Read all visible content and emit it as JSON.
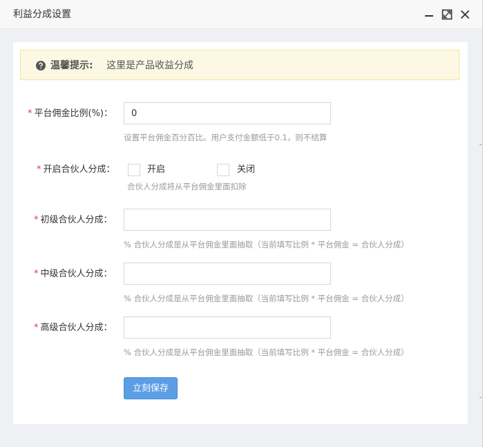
{
  "window": {
    "title": "利益分成设置",
    "controls": [
      "minimize-icon",
      "maximize-icon",
      "close-icon"
    ]
  },
  "notice": {
    "icon": "question-circle-icon",
    "strong": "温馨提示:",
    "text": "这里是产品收益分成"
  },
  "form": {
    "platform_rate": {
      "required_mark": "*",
      "label": "平台佣金比例(%)：",
      "value": "0",
      "help": "设置平台佣金百分百比。用户支付金额低于0.1，则不结算"
    },
    "partner_enable": {
      "required_mark": "*",
      "label": "开启合伙人分成：",
      "option_on": "开启",
      "option_off": "关闭",
      "help": "合伙人分成将从平台佣金里面扣除"
    },
    "level1": {
      "required_mark": "*",
      "label": "初级合伙人分成：",
      "value": "",
      "help": "% 合伙人分成是从平台佣金里面抽取（当前填写比例 * 平台佣金 = 合伙人分成）"
    },
    "level2": {
      "required_mark": "*",
      "label": "中级合伙人分成：",
      "value": "",
      "help": "% 合伙人分成是从平台佣金里面抽取（当前填写比例 * 平台佣金 = 合伙人分成）"
    },
    "level3": {
      "required_mark": "*",
      "label": "高级合伙人分成：",
      "value": "",
      "help": "% 合伙人分成是从平台佣金里面抽取（当前填写比例 * 平台佣金 = 合伙人分成）"
    },
    "save_label": "立刻保存"
  },
  "colors": {
    "accent": "#5b9ee6",
    "required": "#e4393c",
    "notice_bg": "#fcf8e3"
  }
}
